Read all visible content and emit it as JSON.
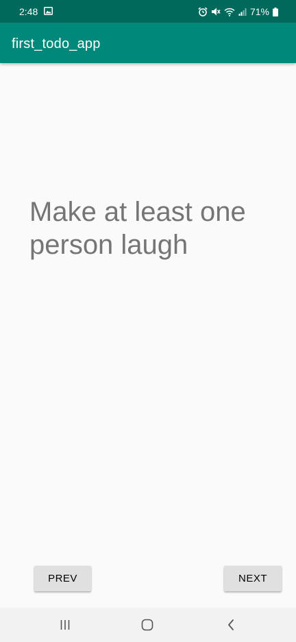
{
  "status_bar": {
    "time": "2:48",
    "battery_percent": "71%",
    "icons": [
      "gallery-icon",
      "alarm-icon",
      "mute-icon",
      "wifi-icon",
      "signal-icon",
      "battery-icon"
    ]
  },
  "app_bar": {
    "title": "first_todo_app",
    "color": "#00897b",
    "status_color": "#00695c"
  },
  "todo": {
    "text": "Make at least one person laugh"
  },
  "buttons": {
    "prev_label": "PREV",
    "next_label": "NEXT"
  },
  "system_nav": {
    "icons": [
      "recents-icon",
      "home-icon",
      "back-icon"
    ]
  }
}
